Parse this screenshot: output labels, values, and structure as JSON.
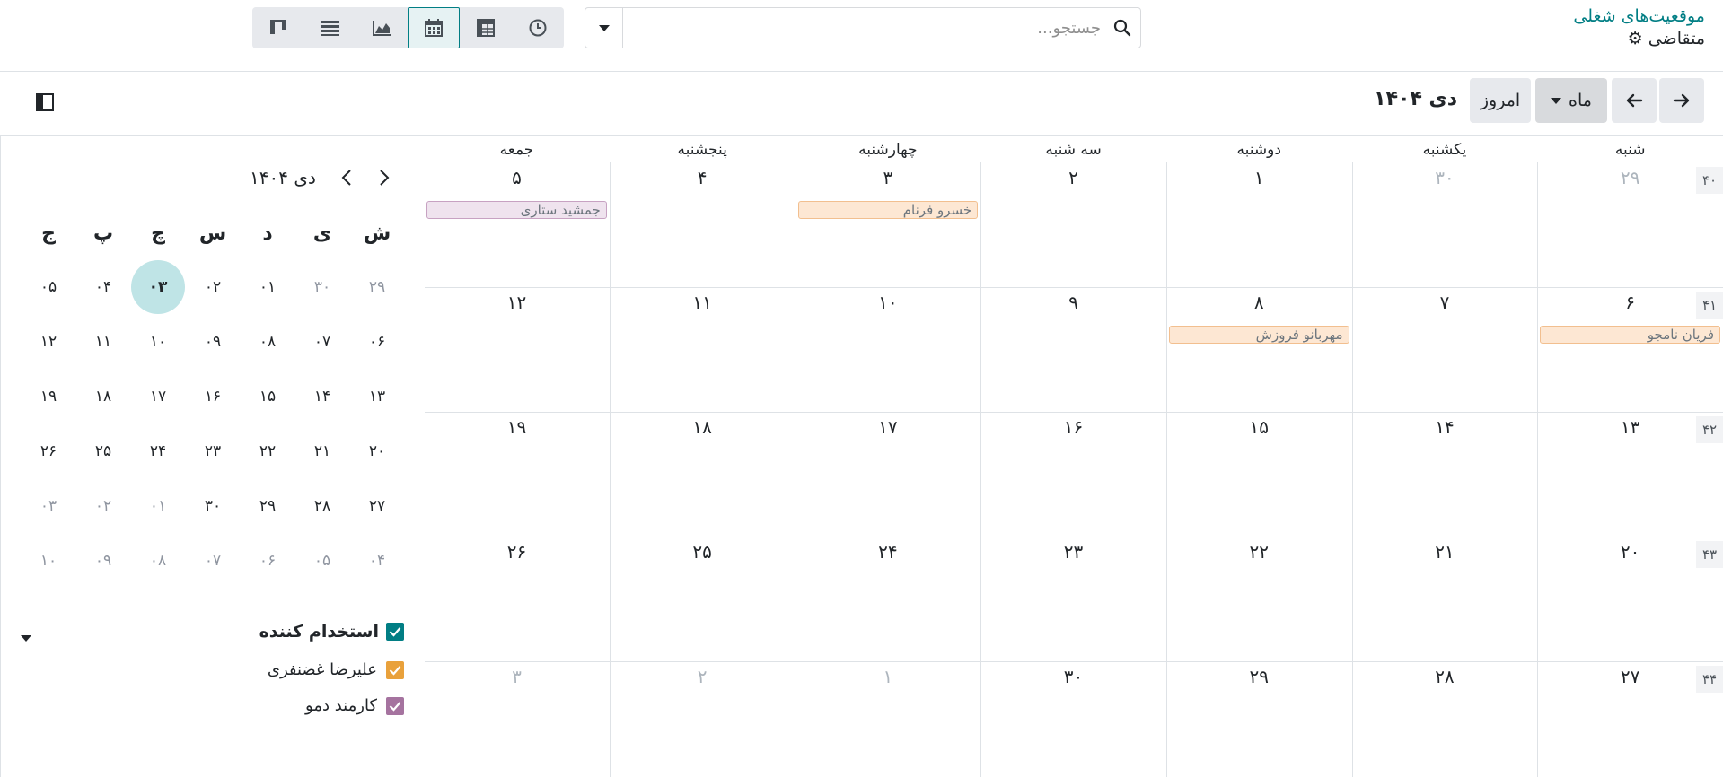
{
  "breadcrumb": {
    "parent": "موقعیت‌های شغلی",
    "current": "متقاضی"
  },
  "search": {
    "placeholder": "جستجو..."
  },
  "view_switcher": {
    "icons": [
      "kanban-icon",
      "list-icon",
      "graph-icon",
      "calendar-icon",
      "pivot-icon",
      "activity-icon"
    ],
    "active": "calendar-icon"
  },
  "toolbar": {
    "scale_label": "ماه",
    "today_label": "امروز",
    "title": "دی ۱۴۰۴"
  },
  "calendar": {
    "weekdays": [
      "شنبه",
      "یکشنبه",
      "دوشنبه",
      "سه شنبه",
      "چهارشنبه",
      "پنجشنبه",
      "جمعه"
    ],
    "weeks": [
      {
        "number": "۴۰",
        "days": [
          {
            "d": "۲۹",
            "m": true
          },
          {
            "d": "۳۰",
            "m": true
          },
          {
            "d": "۱"
          },
          {
            "d": "۲"
          },
          {
            "d": "۳"
          },
          {
            "d": "۴"
          },
          {
            "d": "۵"
          }
        ]
      },
      {
        "number": "۴۱",
        "days": [
          {
            "d": "۶"
          },
          {
            "d": "۷"
          },
          {
            "d": "۸"
          },
          {
            "d": "۹"
          },
          {
            "d": "۱۰"
          },
          {
            "d": "۱۱"
          },
          {
            "d": "۱۲"
          }
        ]
      },
      {
        "number": "۴۲",
        "days": [
          {
            "d": "۱۳"
          },
          {
            "d": "۱۴"
          },
          {
            "d": "۱۵"
          },
          {
            "d": "۱۶"
          },
          {
            "d": "۱۷"
          },
          {
            "d": "۱۸"
          },
          {
            "d": "۱۹"
          }
        ]
      },
      {
        "number": "۴۳",
        "days": [
          {
            "d": "۲۰"
          },
          {
            "d": "۲۱"
          },
          {
            "d": "۲۲"
          },
          {
            "d": "۲۳"
          },
          {
            "d": "۲۴"
          },
          {
            "d": "۲۵"
          },
          {
            "d": "۲۶"
          }
        ]
      },
      {
        "number": "۴۴",
        "days": [
          {
            "d": "۲۷"
          },
          {
            "d": "۲۸"
          },
          {
            "d": "۲۹"
          },
          {
            "d": "۳۰"
          },
          {
            "d": "۱",
            "m": true
          },
          {
            "d": "۲",
            "m": true
          },
          {
            "d": "۳",
            "m": true
          }
        ]
      }
    ],
    "events": [
      {
        "title": "جمشید ستاری",
        "week": 0,
        "day": 6,
        "color": "purple"
      },
      {
        "title": "خسرو فرنام",
        "week": 0,
        "day": 4,
        "color": "orange"
      },
      {
        "title": "مهربانو فروزش",
        "week": 1,
        "day": 2,
        "color": "orange"
      },
      {
        "title": "فریان نامجو",
        "week": 1,
        "day": 0,
        "color": "orange"
      }
    ]
  },
  "mini_calendar": {
    "title": "دی ۱۴۰۴",
    "weekdays": [
      "ش",
      "ی",
      "د",
      "س",
      "چ",
      "پ",
      "ج"
    ],
    "weeks": [
      [
        {
          "d": "۲۹",
          "m": true
        },
        {
          "d": "۳۰",
          "m": true
        },
        {
          "d": "۰۱"
        },
        {
          "d": "۰۲"
        },
        {
          "d": "۰۳",
          "today": true
        },
        {
          "d": "۰۴"
        },
        {
          "d": "۰۵"
        }
      ],
      [
        {
          "d": "۰۶"
        },
        {
          "d": "۰۷"
        },
        {
          "d": "۰۸"
        },
        {
          "d": "۰۹"
        },
        {
          "d": "۱۰"
        },
        {
          "d": "۱۱"
        },
        {
          "d": "۱۲"
        }
      ],
      [
        {
          "d": "۱۳"
        },
        {
          "d": "۱۴"
        },
        {
          "d": "۱۵"
        },
        {
          "d": "۱۶"
        },
        {
          "d": "۱۷"
        },
        {
          "d": "۱۸"
        },
        {
          "d": "۱۹"
        }
      ],
      [
        {
          "d": "۲۰"
        },
        {
          "d": "۲۱"
        },
        {
          "d": "۲۲"
        },
        {
          "d": "۲۳"
        },
        {
          "d": "۲۴"
        },
        {
          "d": "۲۵"
        },
        {
          "d": "۲۶"
        }
      ],
      [
        {
          "d": "۲۷"
        },
        {
          "d": "۲۸"
        },
        {
          "d": "۲۹"
        },
        {
          "d": "۳۰"
        },
        {
          "d": "۰۱",
          "m": true
        },
        {
          "d": "۰۲",
          "m": true
        },
        {
          "d": "۰۳",
          "m": true
        }
      ],
      [
        {
          "d": "۰۴",
          "m": true
        },
        {
          "d": "۰۵",
          "m": true
        },
        {
          "d": "۰۶",
          "m": true
        },
        {
          "d": "۰۷",
          "m": true
        },
        {
          "d": "۰۸",
          "m": true
        },
        {
          "d": "۰۹",
          "m": true
        },
        {
          "d": "۱۰",
          "m": true
        }
      ]
    ]
  },
  "filters": {
    "heading": "استخدام کننده",
    "items": [
      {
        "label": "علیرضا غضنفری",
        "color": "#e9a13b"
      },
      {
        "label": "کارمند دمو",
        "color": "#a5739f"
      }
    ],
    "heading_color": "#017e84"
  }
}
